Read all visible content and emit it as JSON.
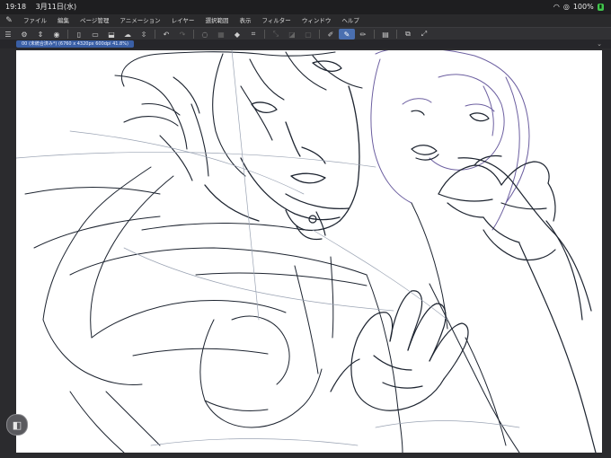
{
  "status_bar": {
    "time": "19:18",
    "date": "3月11日(水)",
    "battery": "100%"
  },
  "menu": {
    "items": [
      "ファイル",
      "編集",
      "ページ管理",
      "アニメーション",
      "レイヤー",
      "選択範囲",
      "表示",
      "フィルター",
      "ウィンドウ",
      "ヘルプ"
    ]
  },
  "toolbar": {
    "icons": [
      "menu-icon",
      "gear-icon",
      "select-arrows-icon",
      "color-wheel-icon",
      "new-document-icon",
      "open-folder-icon",
      "save-icon",
      "cloud-icon",
      "stepper-icon",
      "undo-icon",
      "redo-icon",
      "lasso-icon",
      "deselect-icon",
      "fill-icon",
      "crop-icon",
      "transform-icon",
      "scale-icon",
      "clear-icon",
      "pen-icon",
      "brush-icon",
      "pencil-icon",
      "layer-icon",
      "copy-layer-icon",
      "expand-icon"
    ]
  },
  "document_tab": {
    "label": "00 (未統合済み*) (6760 x 4320px 600dpi 41.8%)"
  },
  "colors": {
    "background": "#2b2b2e",
    "accent": "#4a6fb0",
    "sketch_dark": "#1d2430",
    "sketch_purple": "#6c5fa0"
  }
}
